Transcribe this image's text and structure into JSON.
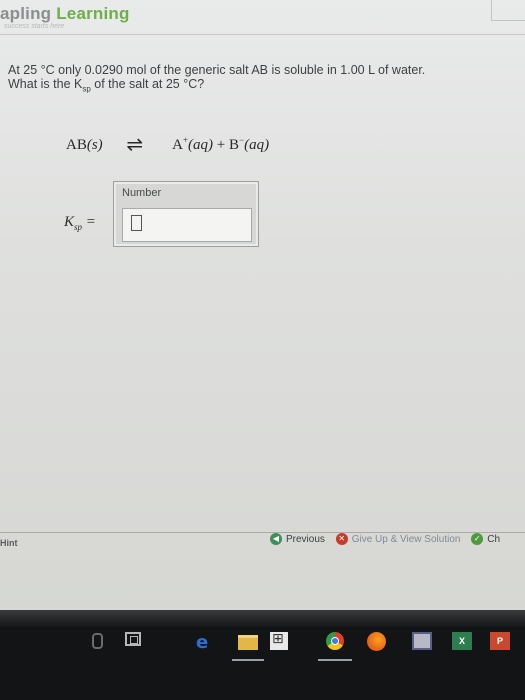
{
  "header": {
    "brand_prefix": "apling",
    "brand_suffix": "Learning",
    "tagline": "success starts here"
  },
  "question": {
    "line1": "At 25 °C only 0.0290 mol of the generic salt AB is soluble in 1.00 L of water.",
    "line2_pre": "What is the K",
    "line2_sub": "sp",
    "line2_post": " of the salt at 25 °C?"
  },
  "equation": {
    "left": "AB",
    "left_phase": "(s)",
    "arrow": "⇌",
    "cation": "A",
    "cation_charge": "+",
    "cation_phase": "(aq)",
    "plus": " + ",
    "anion": "B",
    "anion_charge": "−",
    "anion_phase": "(aq)"
  },
  "answer": {
    "label": "Number",
    "value": ""
  },
  "ksp_label": {
    "main": "K",
    "sub": "sp",
    "equals": " ="
  },
  "footer": {
    "hint": "Hint",
    "previous": "Previous",
    "give_up": "Give Up & View Solution",
    "check": "Ch"
  },
  "taskbar": {
    "icons": [
      "microphone-icon",
      "task-view-icon",
      "edge-icon",
      "file-explorer-icon",
      "store-icon",
      "chrome-icon",
      "firefox-icon",
      "app-icon",
      "excel-icon",
      "powerpoint-icon"
    ],
    "excel_letter": "X",
    "ppt_letter": "P"
  }
}
